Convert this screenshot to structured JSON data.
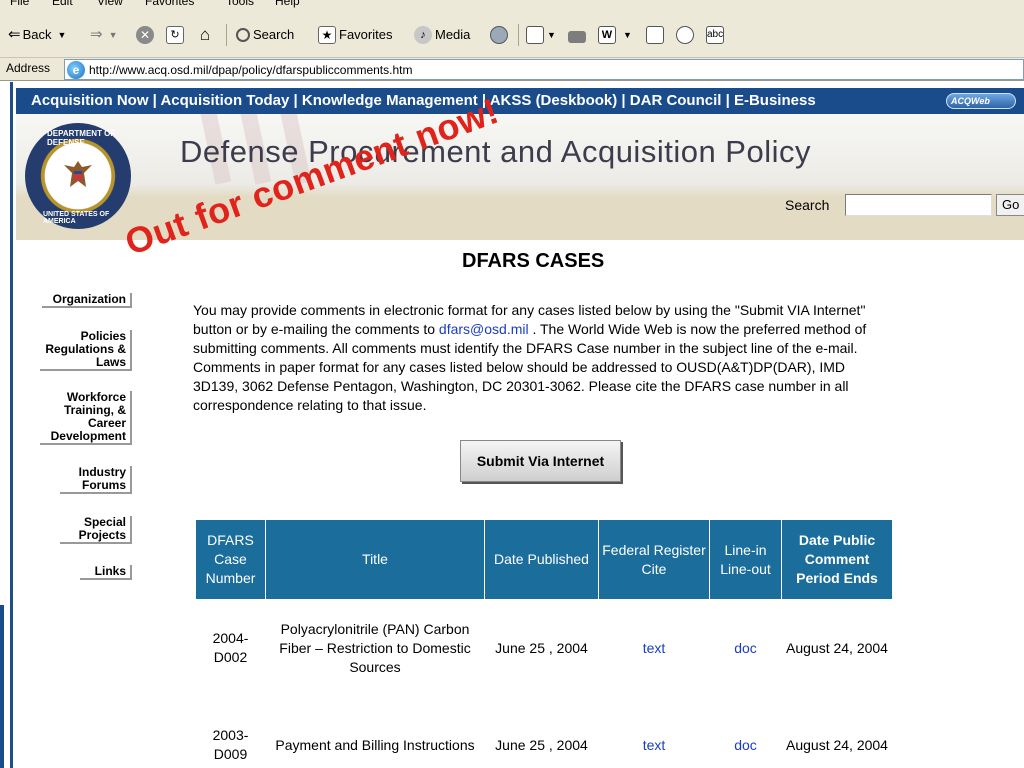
{
  "browser": {
    "menu": [
      "File",
      "Edit",
      "View",
      "Favorites",
      "Tools",
      "Help"
    ],
    "toolbar": {
      "back_label": "Back",
      "search_label": "Search",
      "favorites_label": "Favorites",
      "media_label": "Media"
    },
    "address_label": "Address",
    "url": "http://www.acq.osd.mil/dpap/policy/dfarspubliccomments.htm"
  },
  "site": {
    "top_nav": "Acquisition Now | Acquisition Today | Knowledge Management | AKSS (Deskbook) | DAR Council | E-Business",
    "logo_text": "ACQWeb",
    "title": "Defense Procurement and Acquisition Policy",
    "search_label": "Search",
    "search_value": "",
    "go_label": "Go",
    "seal_top": "DEPARTMENT OF DEFENSE",
    "seal_bottom": "UNITED STATES OF AMERICA"
  },
  "left_nav": [
    {
      "label": "Organization"
    },
    {
      "label": "Policies Regulations & Laws"
    },
    {
      "label": "Workforce Training, & Career Development"
    },
    {
      "label": "Industry Forums"
    },
    {
      "label": "Special Projects"
    },
    {
      "label": "Links"
    }
  ],
  "content": {
    "stamp": "Out for comment now!",
    "heading": "DFARS CASES",
    "intro_before": "You may provide comments in electronic format for any cases listed below by using the \"Submit VIA Internet\" button or by e-mailing the comments to ",
    "email": "dfars@osd.mil",
    "intro_after": " . The World Wide Web is now the preferred method of submitting comments.  All comments must identify the DFARS Case number in the subject line of the e-mail.  Comments in paper format for any cases listed below should be addressed to OUSD(A&T)DP(DAR), IMD 3D139, 3062 Defense Pentagon, Washington, DC 20301-3062.  Please cite the DFARS case number in all correspondence relating to that issue.",
    "submit_label": "Submit Via Internet"
  },
  "table": {
    "headers": [
      "DFARS Case Number",
      "Title",
      "Date Published",
      "Federal Register Cite",
      "Line-in Line-out",
      "Date Public Comment Period Ends"
    ],
    "rows": [
      {
        "case": "2004-D002",
        "title": "Polyacrylonitrile (PAN) Carbon Fiber – Restriction to Domestic Sources",
        "published": "June 25 , 2004",
        "cite": "text",
        "line": "doc",
        "ends": "August 24, 2004"
      },
      {
        "case": "2003-D009",
        "title": "Payment and Billing Instructions",
        "published": "June 25 , 2004",
        "cite": "text",
        "line": "doc",
        "ends": "August 24, 2004"
      }
    ]
  }
}
